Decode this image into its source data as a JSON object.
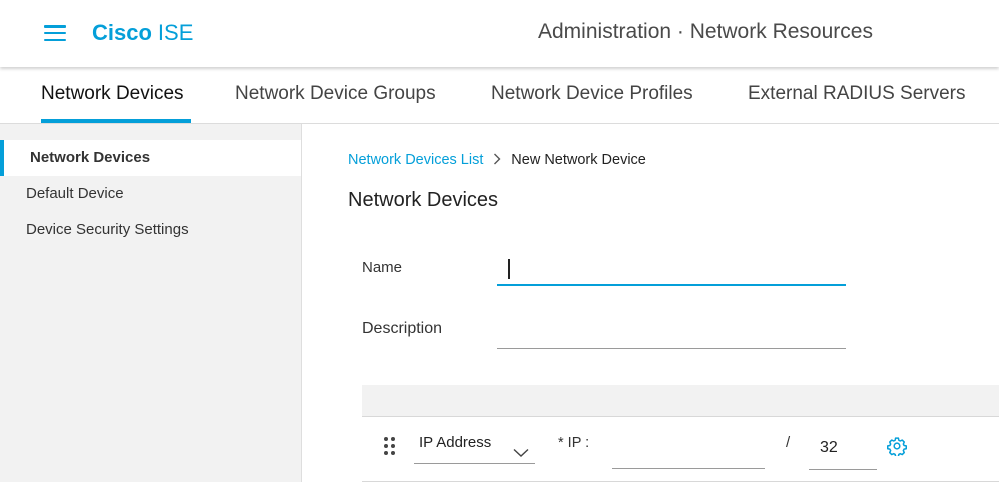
{
  "header": {
    "brand_bold": "Cisco",
    "brand_light": "ISE",
    "page_heading": "Administration · Network Resources",
    "menu_icon": "hamburger-menu-icon",
    "accent": "#049fd9"
  },
  "tabs": [
    {
      "label": "Network Devices",
      "active": true
    },
    {
      "label": "Network Device Groups",
      "active": false
    },
    {
      "label": "Network Device Profiles",
      "active": false
    },
    {
      "label": "External RADIUS Servers",
      "active": false
    }
  ],
  "sidebar": {
    "items": [
      {
        "label": "Network Devices",
        "active": true
      },
      {
        "label": "Default Device",
        "active": false
      },
      {
        "label": "Device Security Settings",
        "active": false
      }
    ]
  },
  "breadcrumb": {
    "parent": "Network Devices List",
    "current": "New Network Device",
    "separator_icon": "chevron-right-icon"
  },
  "main": {
    "title": "Network Devices",
    "name_label": "Name",
    "name_value": "",
    "description_label": "Description",
    "description_value": ""
  },
  "ip_row": {
    "type_value": "IP Address",
    "type_icon": "chevron-down-icon",
    "ip_label": "* IP :",
    "ip_value": "",
    "slash": "/",
    "mask_value": "32",
    "drag_icon": "drag-handle-icon",
    "settings_icon": "gear-icon"
  }
}
